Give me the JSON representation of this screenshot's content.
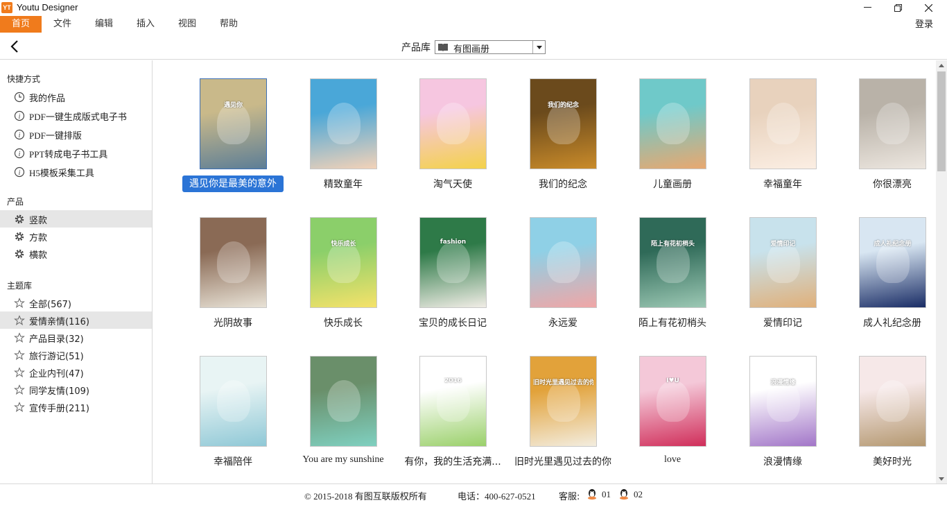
{
  "app": {
    "logo_text": "YT",
    "title": "Youtu Designer"
  },
  "menu": {
    "items": [
      "首页",
      "文件",
      "编辑",
      "插入",
      "视图",
      "帮助"
    ],
    "active": "首页",
    "login": "登录"
  },
  "toolbar": {
    "library_label": "产品库",
    "library_value": "有图画册"
  },
  "sidebar": {
    "shortcuts_title": "快捷方式",
    "shortcuts": [
      "我的作品",
      "PDF一键生成版式电子书",
      "PDF一键排版",
      "PPT转成电子书工具",
      "H5模板采集工具"
    ],
    "products_title": "产品",
    "products": [
      "竖款",
      "方款",
      "横款"
    ],
    "products_selected": "竖款",
    "themes_title": "主题库",
    "themes": [
      "全部(567)",
      "爱情亲情(116)",
      "产品目录(32)",
      "旅行游记(51)",
      "企业内刊(47)",
      "同学友情(109)",
      "宣传手册(211)"
    ],
    "themes_selected": "爱情亲情(116)"
  },
  "templates": [
    {
      "title": "遇见你是最美的意外",
      "cover_text": "遇见你",
      "colors": [
        "#c9b98a",
        "#5d7e96"
      ],
      "selected": true
    },
    {
      "title": "精致童年",
      "cover_text": "",
      "colors": [
        "#4aa7d8",
        "#f3d2b8"
      ]
    },
    {
      "title": "淘气天使",
      "cover_text": "",
      "colors": [
        "#f6c6e0",
        "#f4d24a"
      ]
    },
    {
      "title": "我们的纪念",
      "cover_text": "我们的纪念",
      "colors": [
        "#6b4a1c",
        "#c98b2a"
      ]
    },
    {
      "title": "儿童画册",
      "cover_text": "",
      "colors": [
        "#6fc9c9",
        "#e8a870"
      ]
    },
    {
      "title": "幸福童年",
      "cover_text": "",
      "colors": [
        "#e8d2bd",
        "#fbeee3"
      ]
    },
    {
      "title": "你很漂亮",
      "cover_text": "",
      "colors": [
        "#b9b2a8",
        "#ece6df"
      ]
    },
    {
      "title": "光阴故事",
      "cover_text": "",
      "colors": [
        "#8a6a55",
        "#e8e2d6"
      ]
    },
    {
      "title": "快乐成长",
      "cover_text": "快乐成长",
      "colors": [
        "#8bcf6a",
        "#f5e26a"
      ]
    },
    {
      "title": "宝贝的成长日记",
      "cover_text": "fashion",
      "colors": [
        "#2e7a48",
        "#f1ede6"
      ]
    },
    {
      "title": "永远爱",
      "cover_text": "",
      "colors": [
        "#8fd0e6",
        "#f0a6a6"
      ]
    },
    {
      "title": "陌上有花初梢头",
      "cover_text": "陌上有花初梢头",
      "colors": [
        "#2f6a58",
        "#9cc8b4"
      ]
    },
    {
      "title": "爱情印记",
      "cover_text": "爱情印记",
      "colors": [
        "#c8e2ec",
        "#e0b07a"
      ]
    },
    {
      "title": "成人礼纪念册",
      "cover_text": "成人礼纪念册",
      "colors": [
        "#d8e6f2",
        "#1a2d66"
      ]
    },
    {
      "title": "幸福陪伴",
      "cover_text": "",
      "colors": [
        "#e8f4f4",
        "#8fc8d6"
      ]
    },
    {
      "title": "You are my sunshine",
      "cover_text": "",
      "colors": [
        "#6a8f6a",
        "#7fd0c0"
      ]
    },
    {
      "title": "有你，我的生活充满...",
      "cover_text": "2016",
      "colors": [
        "#fff",
        "#9ad06a"
      ]
    },
    {
      "title": "旧时光里遇见过去的你",
      "cover_text": "旧时光里遇见过去的你",
      "colors": [
        "#e2a23a",
        "#f3eddf"
      ]
    },
    {
      "title": "love",
      "cover_text": "I♥U",
      "colors": [
        "#f4c8d8",
        "#d02e5a"
      ]
    },
    {
      "title": "浪漫情缘",
      "cover_text": "浪漫情缘",
      "colors": [
        "#fff",
        "#a276c8"
      ]
    },
    {
      "title": "美好时光",
      "cover_text": "",
      "colors": [
        "#f6e8e8",
        "#b49870"
      ]
    }
  ],
  "footer": {
    "copyright": "© 2015-2018 有图互联版权所有",
    "phone": "电话：400-627-0521",
    "service_label": "客服:",
    "qq1": "01",
    "qq2": "02"
  },
  "colors": {
    "accent": "#f07b1c",
    "selection": "#2b74d6"
  }
}
